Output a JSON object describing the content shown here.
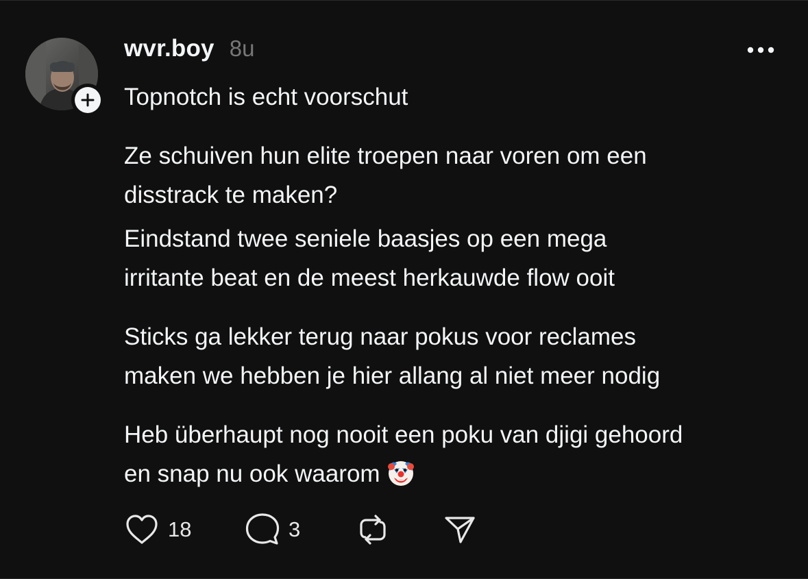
{
  "post": {
    "username": "wvr.boy",
    "timestamp": "8u",
    "paragraphs": [
      "Topnotch is echt voorschut",
      "Ze schuiven hun elite troepen naar voren om een\ndisstrack te maken?",
      "Eindstand twee seniele baasjes op een mega\nirritante beat en de meest herkauwde flow ooit",
      "Sticks ga lekker terug naar pokus voor reclames\nmaken we hebben je hier allang al niet meer nodig",
      "Heb überhaupt nog nooit een poku van djigi gehoord\nen snap nu ook waarom"
    ],
    "emoji": "clown-face"
  },
  "actions": {
    "like_count": "18",
    "reply_count": "3"
  },
  "icons": {
    "avatar": "profile-photo",
    "follow": "plus-icon",
    "more": "more-options-icon",
    "like": "heart-icon",
    "reply": "comment-icon",
    "repost": "repost-icon",
    "share": "send-icon"
  },
  "colors": {
    "background": "#101010",
    "text": "#f3f5f7",
    "muted": "#777777"
  }
}
